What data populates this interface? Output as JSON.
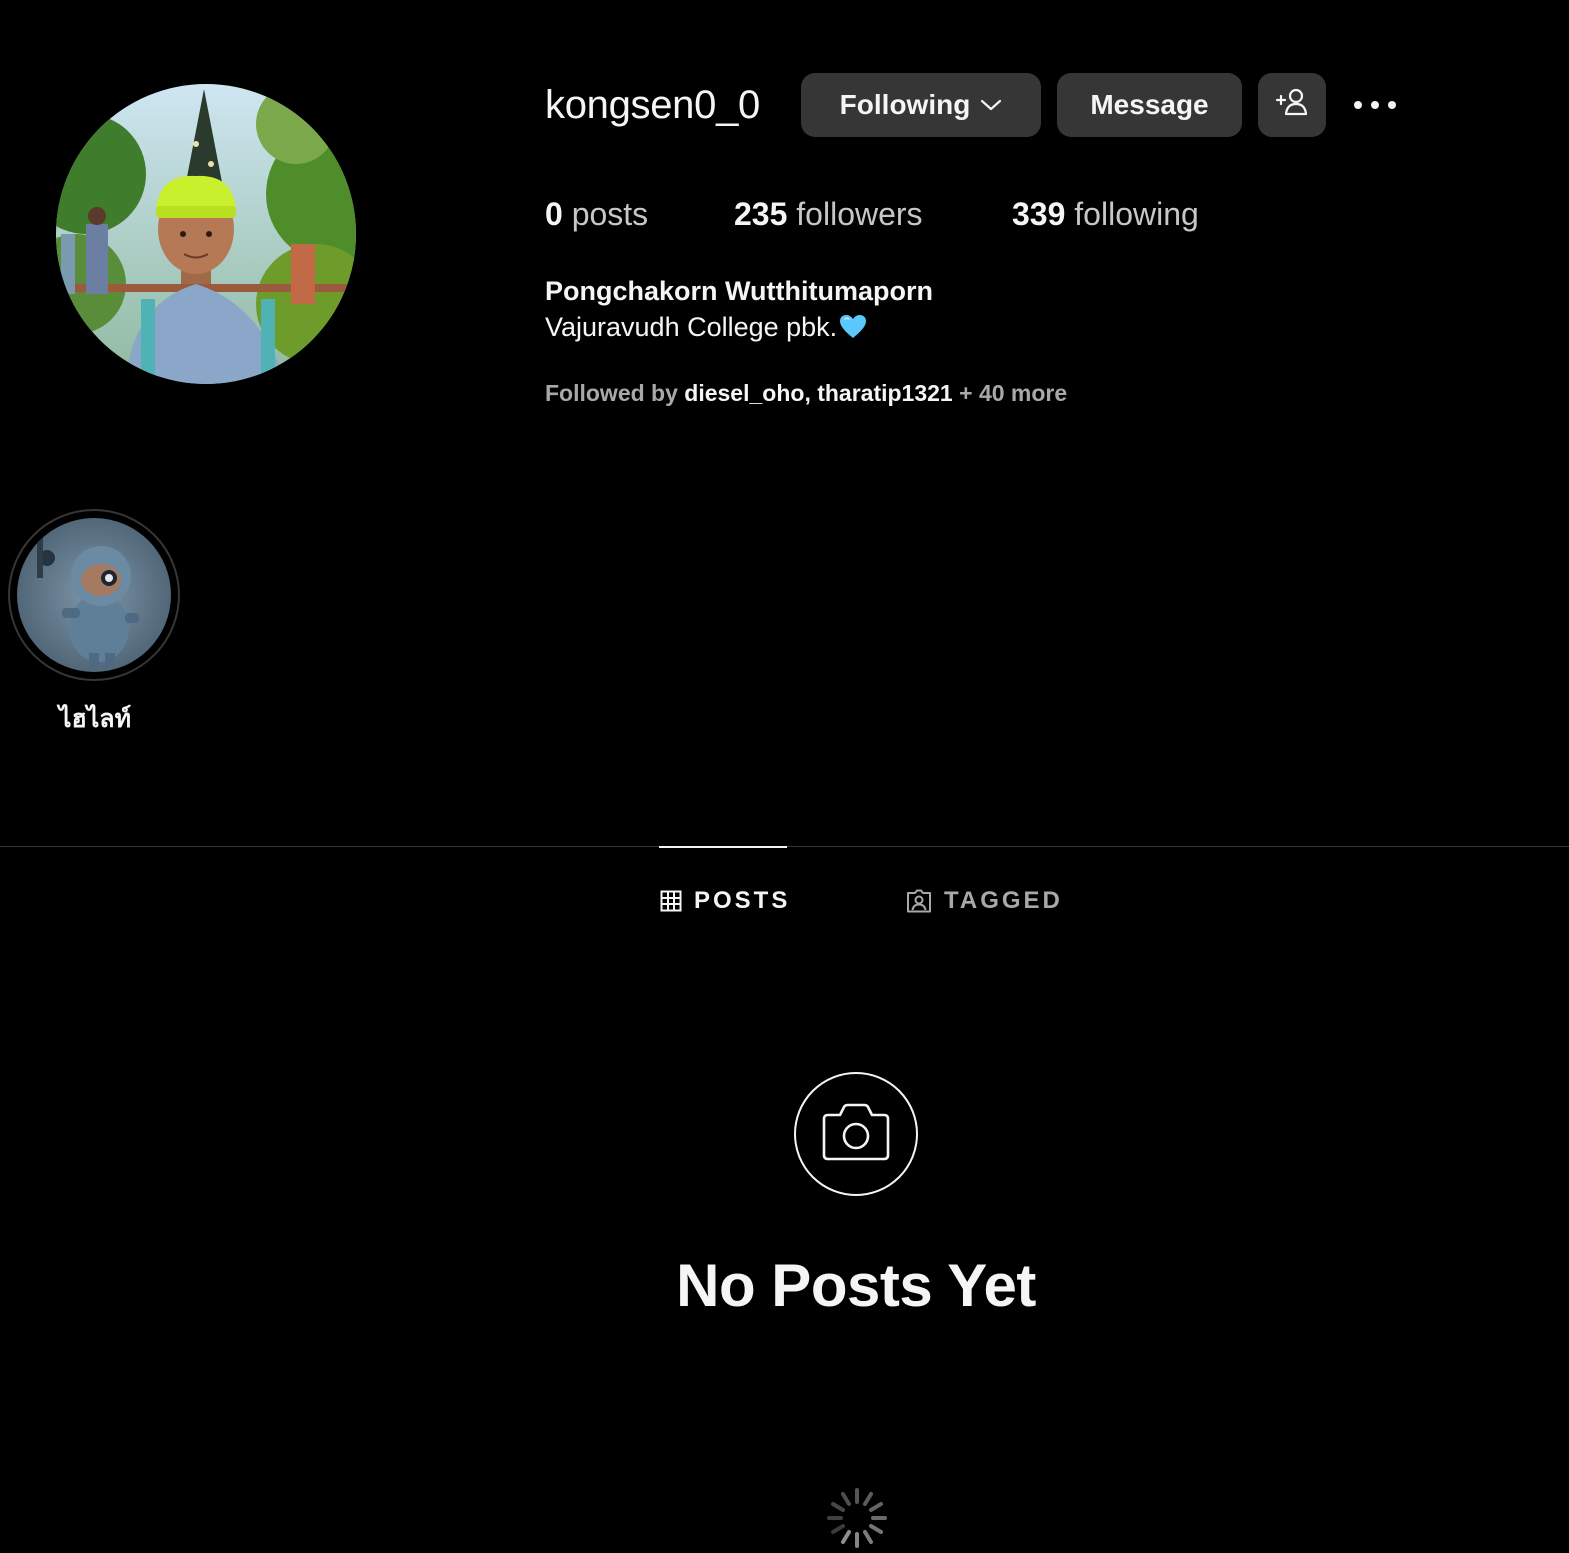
{
  "profile": {
    "username": "kongsen0_0",
    "full_name": "Pongchakorn Wutthitumaporn",
    "bio": "Vajuravudh College pbk.",
    "bio_emoji": "light-blue-heart-icon"
  },
  "actions": {
    "following_label": "Following",
    "message_label": "Message",
    "add_user_icon": "add-user-icon",
    "more_icon": "more-options-icon"
  },
  "stats": {
    "posts_count": "0",
    "posts_label": "posts",
    "followers_count": "235",
    "followers_label": "followers",
    "following_count": "339",
    "following_label": "following"
  },
  "followed_by": {
    "prefix": "Followed by",
    "user1": "diesel_oho",
    "separator": ",",
    "user2": "tharatip1321",
    "more": "+ 40 more"
  },
  "highlights": [
    {
      "label": "ไฮไลท์"
    }
  ],
  "tabs": {
    "posts_label": "POSTS",
    "tagged_label": "TAGGED",
    "active": "POSTS"
  },
  "empty_state": {
    "title": "No Posts Yet",
    "icon": "camera-icon"
  },
  "colors": {
    "background": "#000000",
    "button_bg": "#363636",
    "text_primary": "#f5f5f5",
    "text_secondary": "#a8a8a8",
    "heart": "#5ac8fa"
  }
}
